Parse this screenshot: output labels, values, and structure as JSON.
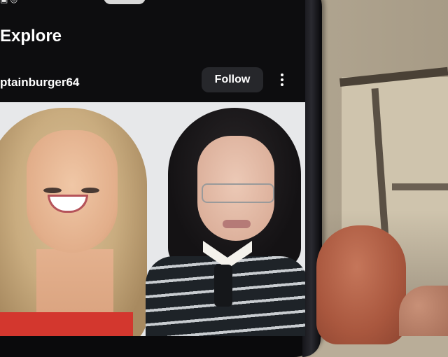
{
  "status_bar": {
    "left_icons": "▣ ◎",
    "right_icons": "▤ ✉ ▼ ▮ ▮▮▮"
  },
  "header": {
    "title": "Explore"
  },
  "post": {
    "username": "ptainburger64",
    "follow_label": "Follow",
    "more_icon": "more-vertical-icon"
  },
  "colors": {
    "screen_bg": "#0d0d0f",
    "follow_bg": "#26272b",
    "text": "#ffffff"
  }
}
